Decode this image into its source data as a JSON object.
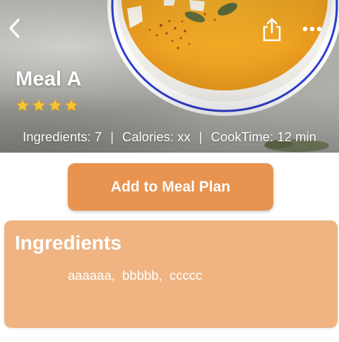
{
  "header": {
    "back_icon": "chevron-left-icon",
    "share_icon": "share-icon",
    "more_icon": "more-horizontal-icon"
  },
  "meal": {
    "title": "Meal A",
    "rating": 4,
    "rating_max": 4,
    "star_color": "#f7c531"
  },
  "meta": {
    "ingredients": "Ingredients: 7",
    "calories": "Calories: xx",
    "cook_time": "CookTime: 12 min",
    "separator": "|"
  },
  "actions": {
    "add_to_meal_plan": "Add to Meal Plan"
  },
  "ingredients_card": {
    "title": "Ingredients",
    "items": [
      "aaaaaa",
      "bbbbb",
      "ccccc"
    ],
    "separator": ",  "
  },
  "colors": {
    "button": "#e8934f",
    "card": "#efb482",
    "text_on_accent": "#ffffff"
  }
}
